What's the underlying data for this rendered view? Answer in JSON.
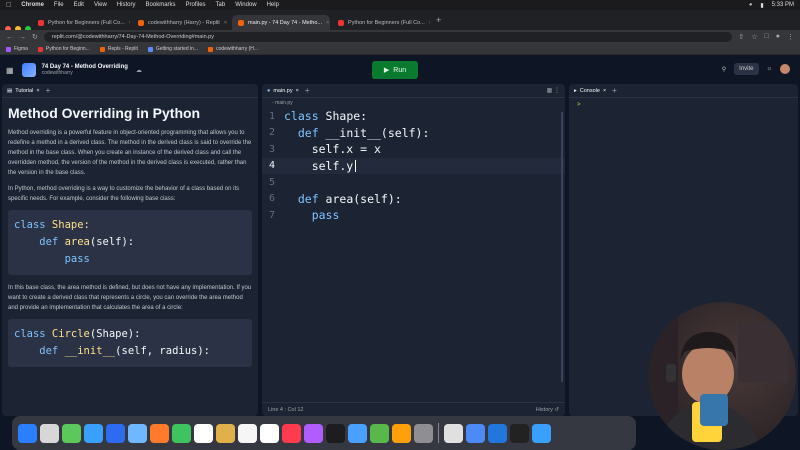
{
  "menubar": {
    "app": "Chrome",
    "items": [
      "File",
      "Edit",
      "View",
      "History",
      "Bookmarks",
      "Profiles",
      "Tab",
      "Window",
      "Help"
    ],
    "time": "5:33 PM"
  },
  "browser": {
    "tabs": [
      {
        "label": "Python for Beginners (Full Co...",
        "active": false,
        "kind": "yt"
      },
      {
        "label": "codewithharry (Harry) - Replit",
        "active": false,
        "kind": "replit"
      },
      {
        "label": "main.py - 74 Day 74 - Metho...",
        "active": true,
        "kind": "replit"
      },
      {
        "label": "Python for Beginners (Full Co...",
        "active": false,
        "kind": "yt"
      }
    ],
    "url": "replit.com/@codewithharry/74-Day-74-Method-Overriding#main.py",
    "bookmarks": [
      "Figma",
      "Python for Beginn...",
      "Repls - Replit",
      "Getting started in...",
      "codewithharry (H..."
    ]
  },
  "replit": {
    "project_name": "74 Day 74 - Method Overriding",
    "owner": "codewithharry",
    "run_label": "Run",
    "invite_label": "Invite"
  },
  "tutorial": {
    "tab_label": "Tutorial",
    "title": "Method Overriding in Python",
    "p1": "Method overriding is a powerful feature in object-oriented programming that allows you to redefine a method in a derived class. The method in the derived class is said to override the method in the base class. When you create an instance of the derived class and call the overridden method, the version of the method in the derived class is executed, rather than the version in the base class.",
    "p2": "In Python, method overriding is a way to customize the behavior of a class based on its specific needs. For example, consider the following base class:",
    "code1": {
      "l1a": "class",
      "l1b": " Shape:",
      "l2a": "    def",
      "l2b": " area",
      "l2c": "(self):",
      "l3": "        pass"
    },
    "p3": "In this base class, the area method is defined, but does not have any implementation. If you want to create a derived class that represents a circle, you can override the area method and provide an implementation that calculates the area of a circle:",
    "code2": {
      "l1a": "class",
      "l1b": " Circle",
      "l1c": "(Shape):",
      "l2a": "    def",
      "l2b": " __init__",
      "l2c": "(self, radius):"
    }
  },
  "editor": {
    "tab_label": "main.py",
    "breadcrumb": "main.py",
    "lines": [
      {
        "n": "1",
        "kw": "class",
        "rest": " Shape:"
      },
      {
        "n": "2",
        "kw": "  def",
        "rest": " __init__(self):"
      },
      {
        "n": "3",
        "kw": "",
        "rest": "    self.x = x"
      },
      {
        "n": "4",
        "kw": "",
        "rest": "    self.y"
      },
      {
        "n": "5",
        "kw": "",
        "rest": ""
      },
      {
        "n": "6",
        "kw": "  def",
        "rest": " area(self):"
      },
      {
        "n": "7",
        "kw": "    pass",
        "rest": ""
      }
    ],
    "status_left": "Line 4 : Col 12",
    "status_right": "History"
  },
  "console": {
    "tab_label": "Console",
    "prompt": ">"
  },
  "dock": {
    "icon_colors": [
      "#2a7fff",
      "#d7d7d7",
      "#5ac85a",
      "#3aa0ff",
      "#2c6cf0",
      "#6fb8ff",
      "#ff7a2a",
      "#3ec45e",
      "#ffffff",
      "#e0b04a",
      "#f6f6f6",
      "#ffffff",
      "#ff3b4f",
      "#b05cff",
      "#1d1d1f",
      "#4aa0ff",
      "#58b84a",
      "#ff9f0a",
      "#8e8e93",
      "#e0e0e0",
      "#4c8bf5",
      "#2277dd",
      "#222",
      "#3aa0ff"
    ]
  }
}
